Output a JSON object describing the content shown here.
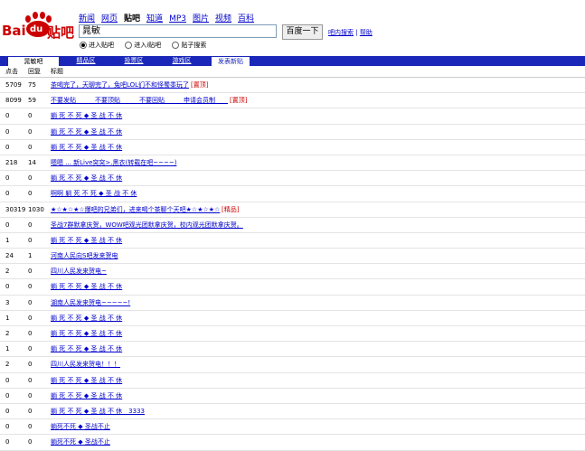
{
  "logo": {
    "bai": "Bai",
    "du": "du",
    "tieba": "贴吧"
  },
  "nav": [
    "新闻",
    "网页",
    "贴吧",
    "知道",
    "MP3",
    "图片",
    "视频",
    "百科"
  ],
  "nav_current": "贴吧",
  "search": {
    "value": "晁敏",
    "button": "百度一下"
  },
  "links": {
    "help_search": "吧内搜索",
    "help": "帮助"
  },
  "radios": [
    {
      "label": "进入贴吧",
      "checked": true
    },
    {
      "label": "进入i贴吧",
      "checked": false
    },
    {
      "label": "贴子搜索",
      "checked": false
    }
  ],
  "tabs": {
    "current": "晁敏吧",
    "good": "精品区",
    "vote": "投票区",
    "game": "游戏区",
    "post": "发表新贴"
  },
  "columns": {
    "clicks": "点击",
    "replies": "回复",
    "title": "标题"
  },
  "rows": [
    {
      "clicks": "5709",
      "replies": "75",
      "title": "茶喝完了，天聊完了，兔吧LOL们不和怪蜀黍玩了",
      "tag": "[置顶]"
    },
    {
      "clicks": "8099",
      "replies": "59",
      "title": "不要发贴　　　不要顶贴　　　不要回贴　　　申请会员制　　",
      "tag": "[置顶]"
    },
    {
      "clicks": "0",
      "replies": "0",
      "title": "躺 死 不 死 ◆ 圣 战 不 休",
      "tag": ""
    },
    {
      "clicks": "0",
      "replies": "0",
      "title": "躺 死 不 死 ◆ 圣 战 不 休",
      "tag": ""
    },
    {
      "clicks": "0",
      "replies": "0",
      "title": "躺 死 不 死 ◆ 圣 战 不 休",
      "tag": ""
    },
    {
      "clicks": "218",
      "replies": "14",
      "title": "嗯嗯 ... 新Live突突>.黑衣(转载在吧~~~~)",
      "tag": ""
    },
    {
      "clicks": "0",
      "replies": "0",
      "title": "躺 死 不 死 ◆ 圣 战 不 休",
      "tag": ""
    },
    {
      "clicks": "0",
      "replies": "0",
      "title": "啊啊 躺 死 不 死 ◆ 圣 战 不 休",
      "tag": ""
    },
    {
      "clicks": "30319",
      "replies": "1030",
      "title": "★☆★☆★☆爆吧的兄弟们，进来喝个茶聊个天吧★☆★☆★☆",
      "tag": "[精品]"
    },
    {
      "clicks": "0",
      "replies": "0",
      "title": "圣战7群默拿庆贺，WOW吧观光团默拿庆贺，校内观光团默拿庆贺。",
      "tag": ""
    },
    {
      "clicks": "1",
      "replies": "0",
      "title": "躺 死 不 死 ◆ 圣 战 不 休",
      "tag": ""
    },
    {
      "clicks": "24",
      "replies": "1",
      "title": "河南人民向S吧发来贺电",
      "tag": ""
    },
    {
      "clicks": "2",
      "replies": "0",
      "title": "四川人民发来贺电~",
      "tag": ""
    },
    {
      "clicks": "0",
      "replies": "0",
      "title": "躺 死 不 死 ◆ 圣 战 不 休",
      "tag": ""
    },
    {
      "clicks": "3",
      "replies": "0",
      "title": "湖南人民发来贺电~~~~~!",
      "tag": ""
    },
    {
      "clicks": "1",
      "replies": "0",
      "title": "躺 死 不 死 ◆ 圣 战 不 休",
      "tag": ""
    },
    {
      "clicks": "2",
      "replies": "0",
      "title": "躺 死 不 死 ◆ 圣 战 不 休",
      "tag": ""
    },
    {
      "clicks": "1",
      "replies": "0",
      "title": "躺 死 不 死 ◆ 圣 战 不 休",
      "tag": ""
    },
    {
      "clicks": "2",
      "replies": "0",
      "title": "四川人民发来贺电！！！",
      "tag": ""
    },
    {
      "clicks": "0",
      "replies": "0",
      "title": "躺 死 不 死 ◆ 圣 战 不 休",
      "tag": ""
    },
    {
      "clicks": "0",
      "replies": "0",
      "title": "躺 死 不 死 ◆ 圣 战 不 休",
      "tag": ""
    },
    {
      "clicks": "0",
      "replies": "0",
      "title": "躺 死 不 死 ◆ 圣 战 不 休　3333",
      "tag": ""
    },
    {
      "clicks": "0",
      "replies": "0",
      "title": "躺死不死 ◆ 圣战不止",
      "tag": ""
    },
    {
      "clicks": "0",
      "replies": "0",
      "title": "躺死不死 ◆ 圣战不止",
      "tag": ""
    }
  ],
  "colors": {
    "accent": "#1a27b8",
    "link": "#0000cc",
    "tag": "#cc0000"
  }
}
